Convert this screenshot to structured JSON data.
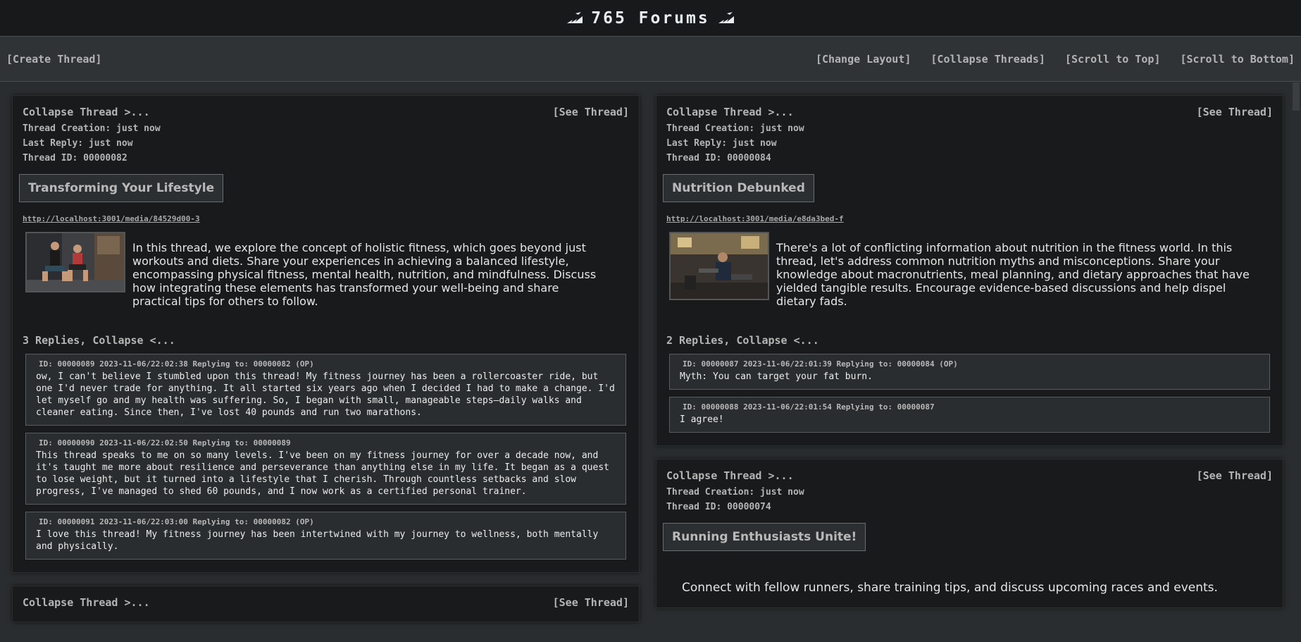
{
  "header": {
    "title": "765 Forums"
  },
  "toolbar": {
    "create": "[Create Thread]",
    "change_layout": "[Change Layout]",
    "collapse_threads": "[Collapse Threads]",
    "scroll_top": "[Scroll to Top]",
    "scroll_bottom": "[Scroll to Bottom]"
  },
  "threads": [
    {
      "collapse": "Collapse Thread >...",
      "see": "[See Thread]",
      "created": "Thread Creation: just now",
      "last_reply": "Last Reply: just now",
      "id": "Thread ID: 00000082",
      "title": "Transforming Your Lifestyle",
      "media": "http://localhost:3001/media/84529d00-3",
      "text": "In this thread, we explore the concept of holistic fitness, which goes beyond just workouts and diets. Share your experiences in achieving a balanced lifestyle, encompassing physical fitness, mental health, nutrition, and mindfulness. Discuss how integrating these elements has transformed your well-being and share practical tips for others to follow.",
      "replies_head": "3 Replies, Collapse <...",
      "replies": [
        {
          "head": "ID: 00000089  2023-11-06/22:02:38  Replying to: 00000082 (OP)",
          "text": "ow, I can't believe I stumbled upon this thread! My fitness journey has been a rollercoaster ride, but one I'd never trade for anything. It all started six years ago when I decided I had to make a change. I'd let myself go and my health was suffering. So, I began with small, manageable steps—daily walks and cleaner eating. Since then, I've lost 40 pounds and run two marathons."
        },
        {
          "head": "ID: 00000090  2023-11-06/22:02:50  Replying to: 00000089",
          "text": "This thread speaks to me on so many levels. I've been on my fitness journey for over a decade now, and it's taught me more about resilience and perseverance than anything else in my life. It began as a quest to lose weight, but it turned into a lifestyle that I cherish. Through countless setbacks and slow progress, I've managed to shed 60 pounds, and I now work as a certified personal trainer."
        },
        {
          "head": "ID: 00000091  2023-11-06/22:03:00  Replying to: 00000082 (OP)",
          "text": "I love this thread! My fitness journey has been intertwined with my journey to wellness, both mentally and physically."
        }
      ]
    },
    {
      "collapse": "Collapse Thread >...",
      "see": "[See Thread]",
      "created": "Thread Creation: just now",
      "last_reply": "Last Reply: just now",
      "id": "Thread ID: 00000084",
      "title": "Nutrition Debunked",
      "media": "http://localhost:3001/media/e8da3bed-f",
      "text": "There's a lot of conflicting information about nutrition in the fitness world. In this thread, let's address common nutrition myths and misconceptions. Share your knowledge about macronutrients, meal planning, and dietary approaches that have yielded tangible results. Encourage evidence-based discussions and help dispel dietary fads.",
      "replies_head": "2 Replies, Collapse <...",
      "replies": [
        {
          "head": "ID: 00000087  2023-11-06/22:01:39  Replying to: 00000084 (OP)",
          "text": "Myth: You can target your fat burn."
        },
        {
          "head": "ID: 00000088  2023-11-06/22:01:54  Replying to: 00000087",
          "text": "I agree!"
        }
      ]
    },
    {
      "collapse": "Collapse Thread >...",
      "see": "[See Thread]",
      "created": "Thread Creation: just now",
      "id": "Thread ID: 00000074",
      "title": "Running Enthusiasts Unite!",
      "text": "Connect with fellow runners, share training tips, and discuss upcoming races and events."
    },
    {
      "collapse": "Collapse Thread >...",
      "see": "[See Thread]"
    }
  ]
}
